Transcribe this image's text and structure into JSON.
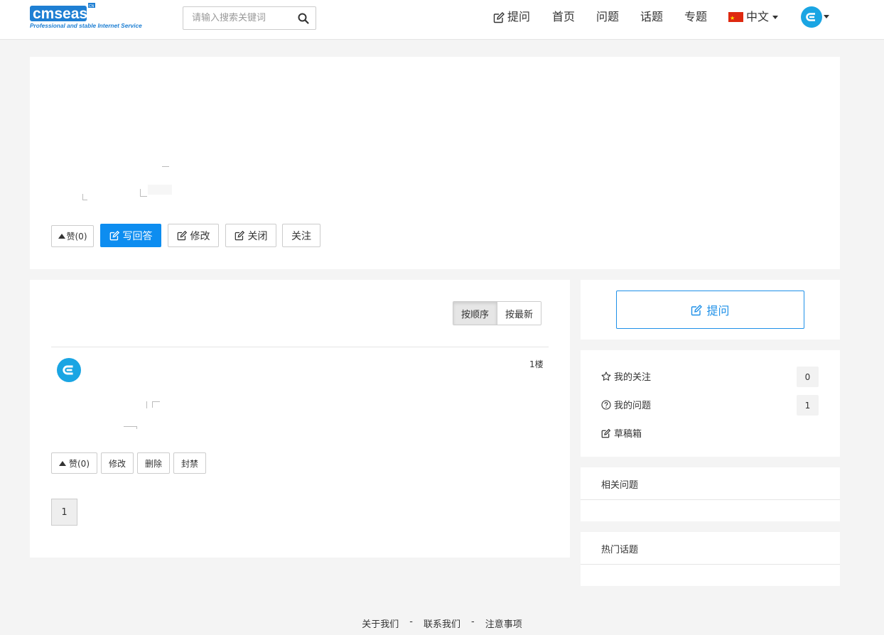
{
  "header": {
    "logo": {
      "main": "cmseasy",
      "tagline": "Professional and stable Internet Service",
      "badge": "CN"
    },
    "search_placeholder": "请输入搜索关键词",
    "nav": {
      "ask": "提问",
      "home": "首页",
      "questions": "问题",
      "topics": "话题",
      "specials": "专题",
      "language": "中文"
    },
    "icons": {
      "search": "search-icon",
      "edit": "edit-icon",
      "flag": "china-flag-icon",
      "avatar": "user-avatar-icon"
    }
  },
  "question": {
    "like_label": "赞(0)",
    "write_answer": "写回答",
    "edit": "修改",
    "close": "关闭",
    "follow": "关注"
  },
  "answers": {
    "sort_order": "按顺序",
    "sort_newest": "按最新",
    "floor": "1楼",
    "like_label": "赞(0)",
    "edit": "修改",
    "delete": "删除",
    "ban": "封禁",
    "page": "1"
  },
  "sidebar": {
    "ask_button": "提问",
    "my_follow": "我的关注",
    "my_follow_count": "0",
    "my_questions": "我的问题",
    "my_questions_count": "1",
    "drafts": "草稿箱",
    "related_title": "相关问题",
    "hot_topics_title": "热门话题"
  },
  "footer": {
    "about": "关于我们",
    "contact": "联系我们",
    "notice": "注意事项",
    "separator": "-"
  },
  "colors": {
    "primary": "#0d8df0",
    "avatar": "#1aa5e3",
    "logo_blue": "#1e7fd3",
    "background": "#f4f4f4"
  }
}
